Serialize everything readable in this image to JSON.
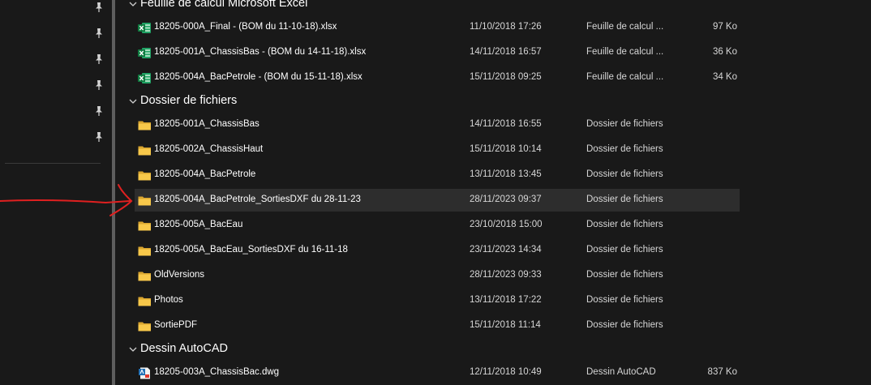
{
  "accent_color": "#e02020",
  "nav": {
    "pins": [
      "pin-icon",
      "pin-icon",
      "pin-icon",
      "pin-icon",
      "pin-icon",
      "pin-icon"
    ]
  },
  "groups": [
    {
      "title": "Feuille de calcul Microsoft Excel",
      "icon": "excel-file-icon",
      "items": [
        {
          "name": "18205-000A_Final - (BOM du 11-10-18).xlsx",
          "date": "11/10/2018 17:26",
          "type": "Feuille de calcul ...",
          "size": "97 Ko"
        },
        {
          "name": "18205-001A_ChassisBas - (BOM du 14-11-18).xlsx",
          "date": "14/11/2018 16:57",
          "type": "Feuille de calcul ...",
          "size": "36 Ko"
        },
        {
          "name": "18205-004A_BacPetrole - (BOM du 15-11-18).xlsx",
          "date": "15/11/2018 09:25",
          "type": "Feuille de calcul ...",
          "size": "34 Ko"
        }
      ]
    },
    {
      "title": "Dossier de fichiers",
      "icon": "folder-icon",
      "items": [
        {
          "name": "18205-001A_ChassisBas",
          "date": "14/11/2018 16:55",
          "type": "Dossier de fichiers",
          "size": ""
        },
        {
          "name": "18205-002A_ChassisHaut",
          "date": "15/11/2018 10:14",
          "type": "Dossier de fichiers",
          "size": ""
        },
        {
          "name": "18205-004A_BacPetrole",
          "date": "13/11/2018 13:45",
          "type": "Dossier de fichiers",
          "size": ""
        },
        {
          "name": "18205-004A_BacPetrole_SortiesDXF du 28-11-23",
          "date": "28/11/2023 09:37",
          "type": "Dossier de fichiers",
          "size": "",
          "selected": true
        },
        {
          "name": "18205-005A_BacEau",
          "date": "23/10/2018 15:00",
          "type": "Dossier de fichiers",
          "size": ""
        },
        {
          "name": "18205-005A_BacEau_SortiesDXF du 16-11-18",
          "date": "23/11/2023 14:34",
          "type": "Dossier de fichiers",
          "size": ""
        },
        {
          "name": "OldVersions",
          "date": "28/11/2023 09:33",
          "type": "Dossier de fichiers",
          "size": ""
        },
        {
          "name": "Photos",
          "date": "13/11/2018 17:22",
          "type": "Dossier de fichiers",
          "size": ""
        },
        {
          "name": "SortiePDF",
          "date": "15/11/2018 11:14",
          "type": "Dossier de fichiers",
          "size": ""
        }
      ]
    },
    {
      "title": "Dessin AutoCAD",
      "icon": "autocad-file-icon",
      "items": [
        {
          "name": "18205-003A_ChassisBac.dwg",
          "date": "12/11/2018 10:49",
          "type": "Dessin AutoCAD",
          "size": "837 Ko"
        }
      ]
    }
  ]
}
